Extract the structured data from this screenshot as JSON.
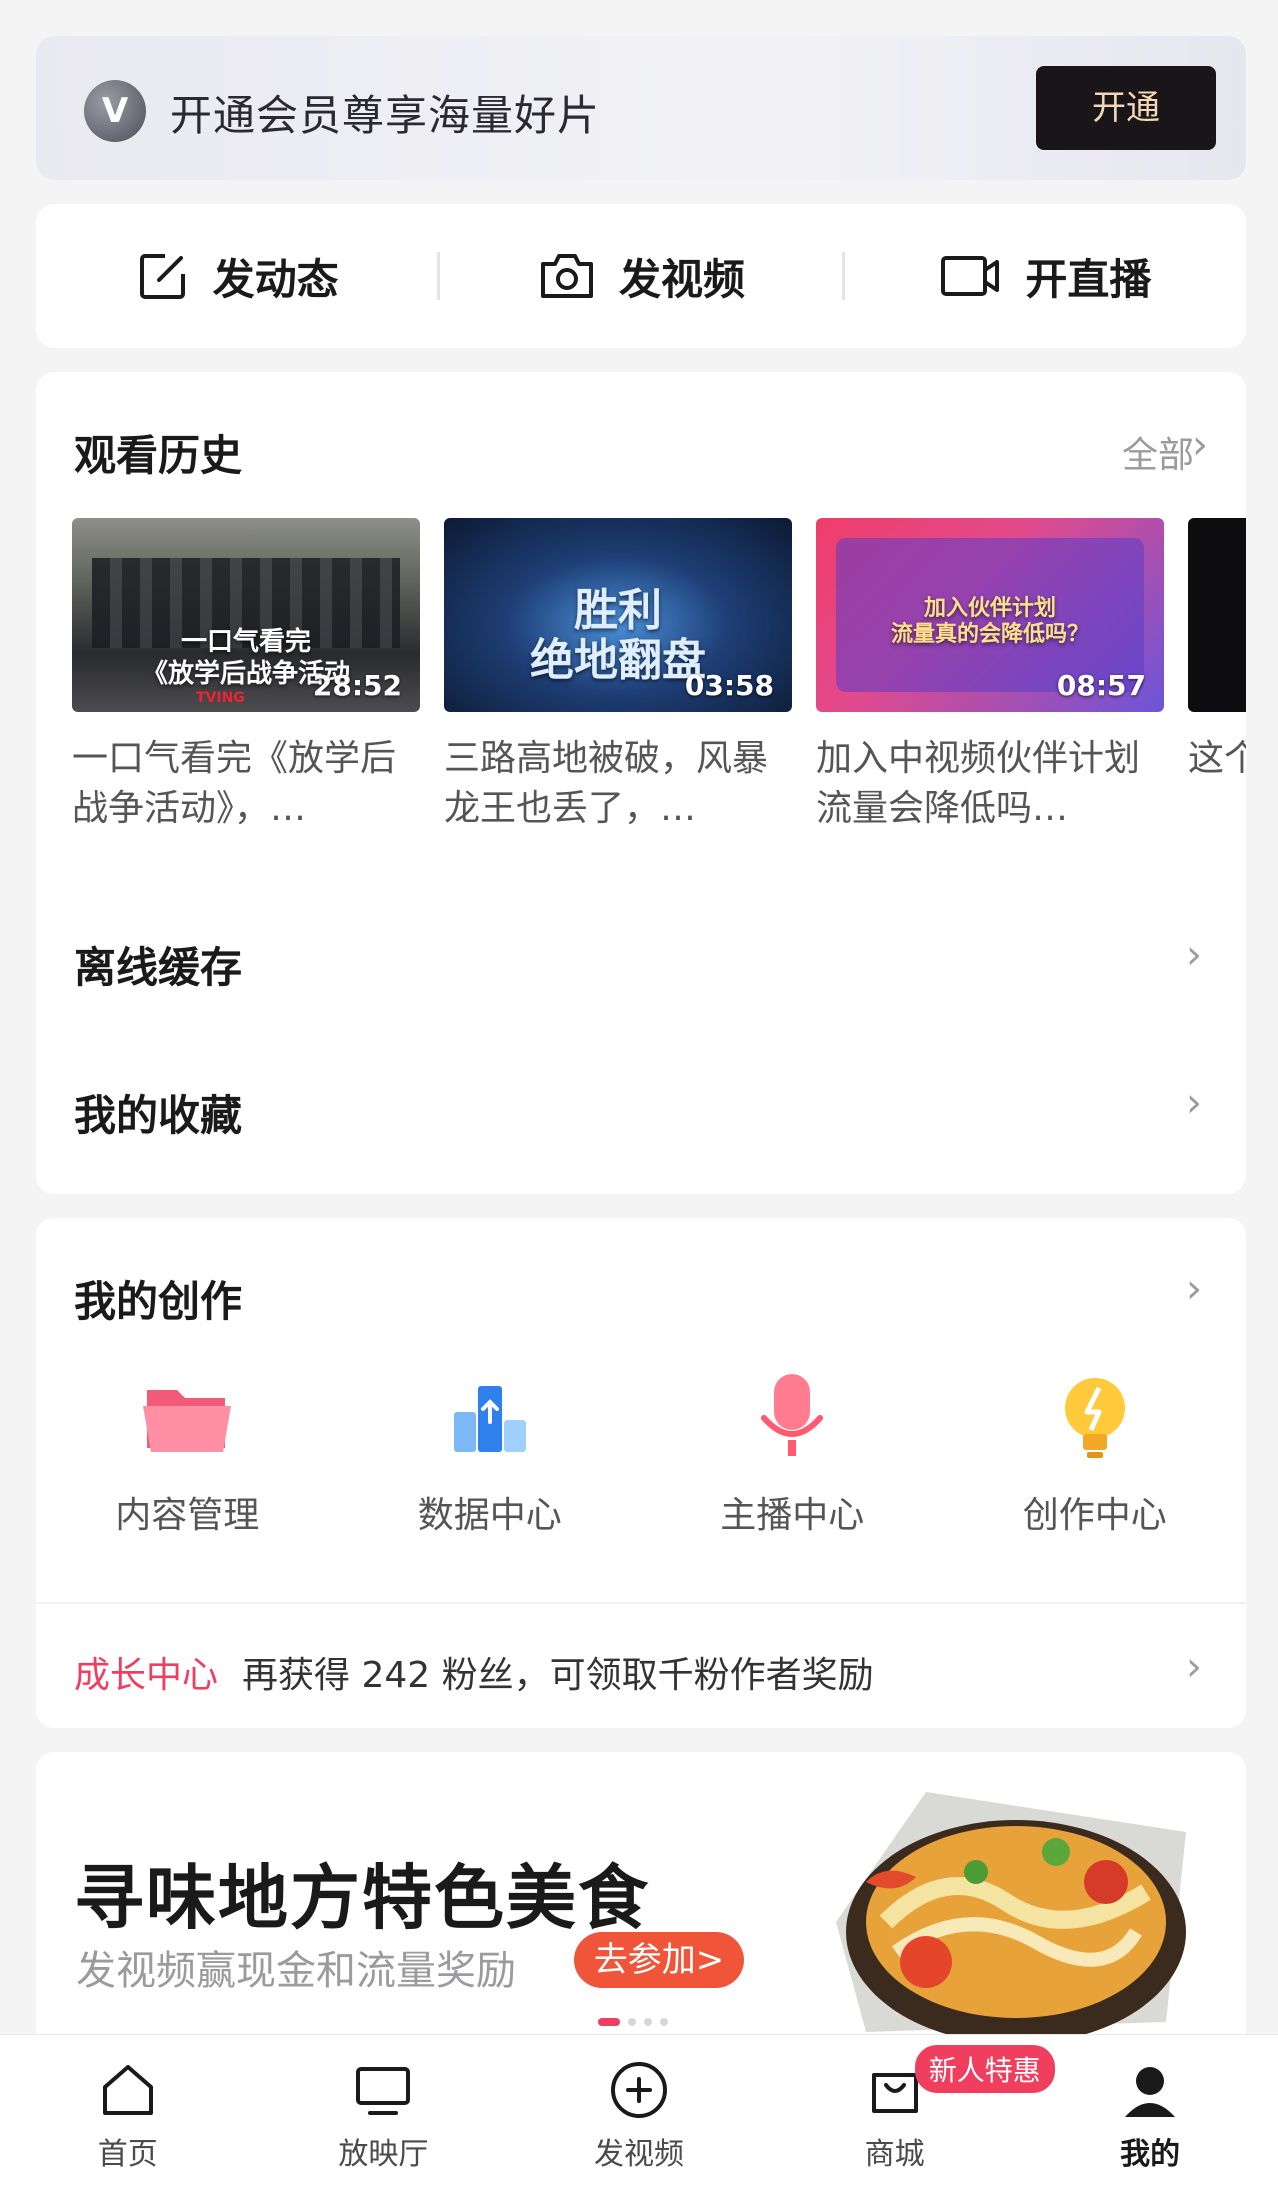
{
  "vip": {
    "logo": "V",
    "text": "开通会员尊享海量好片",
    "button": "开通"
  },
  "post_actions": [
    {
      "label": "发动态",
      "icon": "edit-icon"
    },
    {
      "label": "发视频",
      "icon": "camera-icon"
    },
    {
      "label": "开直播",
      "icon": "video-camera-icon"
    }
  ],
  "history": {
    "title": "观看历史",
    "more": "全部",
    "items": [
      {
        "title": "一口气看完《放学后战争活动》，…",
        "duration": "28:52",
        "caption": "一口气看完\n《放学后战争活动",
        "brand": "TVING"
      },
      {
        "title": "三路高地被破，风暴龙王也丢了，…",
        "duration": "03:58",
        "caption": "胜利\n绝地翻盘"
      },
      {
        "title": "加入中视频伙伴计划流量会降低吗…",
        "duration": "08:57",
        "caption": "加入伙伴计划\n流量真的会降低吗？"
      },
      {
        "title": "这个音乐",
        "duration": ""
      }
    ]
  },
  "offline_cache": {
    "label": "离线缓存"
  },
  "favorites": {
    "label": "我的收藏"
  },
  "creation": {
    "title": "我的创作",
    "tools": [
      {
        "label": "内容管理",
        "icon": "folder-icon"
      },
      {
        "label": "数据中心",
        "icon": "data-chart-icon"
      },
      {
        "label": "主播中心",
        "icon": "microphone-icon"
      },
      {
        "label": "创作中心",
        "icon": "lightbulb-icon"
      }
    ],
    "growth": {
      "tag": "成长中心",
      "text": "再获得 242 粉丝，可领取千粉作者奖励"
    }
  },
  "promo": {
    "title": "寻味地方特色美食",
    "subtitle": "发视频赢现金和流量奖励",
    "button": "去参加>",
    "carousel_pages": 4,
    "active_page": 1
  },
  "tabbar": {
    "tabs": [
      {
        "label": "首页",
        "icon": "home-icon"
      },
      {
        "label": "放映厅",
        "icon": "tv-icon"
      },
      {
        "label": "发视频",
        "icon": "add-circle-icon"
      },
      {
        "label": "商城",
        "icon": "shopping-bag-icon",
        "badge": "新人特惠"
      },
      {
        "label": "我的",
        "icon": "user-icon",
        "active": true
      }
    ]
  },
  "colors": {
    "accent": "#f03e5f",
    "promo_button": "#f0553a",
    "vip_button": "#1a1518",
    "vip_button_text": "#f4d7b8"
  }
}
